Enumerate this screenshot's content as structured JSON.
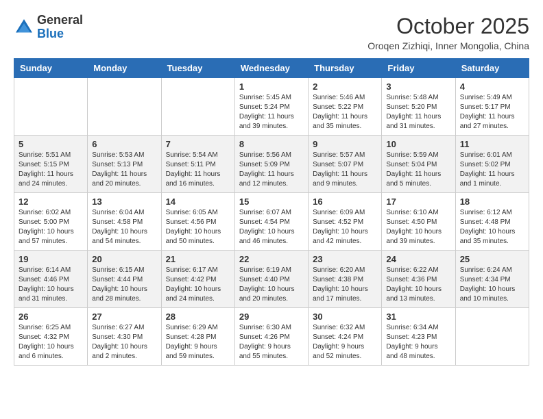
{
  "logo": {
    "general": "General",
    "blue": "Blue"
  },
  "header": {
    "month": "October 2025",
    "location": "Oroqen Zizhiqi, Inner Mongolia, China"
  },
  "weekdays": [
    "Sunday",
    "Monday",
    "Tuesday",
    "Wednesday",
    "Thursday",
    "Friday",
    "Saturday"
  ],
  "weeks": [
    [
      {
        "day": "",
        "info": ""
      },
      {
        "day": "",
        "info": ""
      },
      {
        "day": "",
        "info": ""
      },
      {
        "day": "1",
        "info": "Sunrise: 5:45 AM\nSunset: 5:24 PM\nDaylight: 11 hours\nand 39 minutes."
      },
      {
        "day": "2",
        "info": "Sunrise: 5:46 AM\nSunset: 5:22 PM\nDaylight: 11 hours\nand 35 minutes."
      },
      {
        "day": "3",
        "info": "Sunrise: 5:48 AM\nSunset: 5:20 PM\nDaylight: 11 hours\nand 31 minutes."
      },
      {
        "day": "4",
        "info": "Sunrise: 5:49 AM\nSunset: 5:17 PM\nDaylight: 11 hours\nand 27 minutes."
      }
    ],
    [
      {
        "day": "5",
        "info": "Sunrise: 5:51 AM\nSunset: 5:15 PM\nDaylight: 11 hours\nand 24 minutes."
      },
      {
        "day": "6",
        "info": "Sunrise: 5:53 AM\nSunset: 5:13 PM\nDaylight: 11 hours\nand 20 minutes."
      },
      {
        "day": "7",
        "info": "Sunrise: 5:54 AM\nSunset: 5:11 PM\nDaylight: 11 hours\nand 16 minutes."
      },
      {
        "day": "8",
        "info": "Sunrise: 5:56 AM\nSunset: 5:09 PM\nDaylight: 11 hours\nand 12 minutes."
      },
      {
        "day": "9",
        "info": "Sunrise: 5:57 AM\nSunset: 5:07 PM\nDaylight: 11 hours\nand 9 minutes."
      },
      {
        "day": "10",
        "info": "Sunrise: 5:59 AM\nSunset: 5:04 PM\nDaylight: 11 hours\nand 5 minutes."
      },
      {
        "day": "11",
        "info": "Sunrise: 6:01 AM\nSunset: 5:02 PM\nDaylight: 11 hours\nand 1 minute."
      }
    ],
    [
      {
        "day": "12",
        "info": "Sunrise: 6:02 AM\nSunset: 5:00 PM\nDaylight: 10 hours\nand 57 minutes."
      },
      {
        "day": "13",
        "info": "Sunrise: 6:04 AM\nSunset: 4:58 PM\nDaylight: 10 hours\nand 54 minutes."
      },
      {
        "day": "14",
        "info": "Sunrise: 6:05 AM\nSunset: 4:56 PM\nDaylight: 10 hours\nand 50 minutes."
      },
      {
        "day": "15",
        "info": "Sunrise: 6:07 AM\nSunset: 4:54 PM\nDaylight: 10 hours\nand 46 minutes."
      },
      {
        "day": "16",
        "info": "Sunrise: 6:09 AM\nSunset: 4:52 PM\nDaylight: 10 hours\nand 42 minutes."
      },
      {
        "day": "17",
        "info": "Sunrise: 6:10 AM\nSunset: 4:50 PM\nDaylight: 10 hours\nand 39 minutes."
      },
      {
        "day": "18",
        "info": "Sunrise: 6:12 AM\nSunset: 4:48 PM\nDaylight: 10 hours\nand 35 minutes."
      }
    ],
    [
      {
        "day": "19",
        "info": "Sunrise: 6:14 AM\nSunset: 4:46 PM\nDaylight: 10 hours\nand 31 minutes."
      },
      {
        "day": "20",
        "info": "Sunrise: 6:15 AM\nSunset: 4:44 PM\nDaylight: 10 hours\nand 28 minutes."
      },
      {
        "day": "21",
        "info": "Sunrise: 6:17 AM\nSunset: 4:42 PM\nDaylight: 10 hours\nand 24 minutes."
      },
      {
        "day": "22",
        "info": "Sunrise: 6:19 AM\nSunset: 4:40 PM\nDaylight: 10 hours\nand 20 minutes."
      },
      {
        "day": "23",
        "info": "Sunrise: 6:20 AM\nSunset: 4:38 PM\nDaylight: 10 hours\nand 17 minutes."
      },
      {
        "day": "24",
        "info": "Sunrise: 6:22 AM\nSunset: 4:36 PM\nDaylight: 10 hours\nand 13 minutes."
      },
      {
        "day": "25",
        "info": "Sunrise: 6:24 AM\nSunset: 4:34 PM\nDaylight: 10 hours\nand 10 minutes."
      }
    ],
    [
      {
        "day": "26",
        "info": "Sunrise: 6:25 AM\nSunset: 4:32 PM\nDaylight: 10 hours\nand 6 minutes."
      },
      {
        "day": "27",
        "info": "Sunrise: 6:27 AM\nSunset: 4:30 PM\nDaylight: 10 hours\nand 2 minutes."
      },
      {
        "day": "28",
        "info": "Sunrise: 6:29 AM\nSunset: 4:28 PM\nDaylight: 9 hours\nand 59 minutes."
      },
      {
        "day": "29",
        "info": "Sunrise: 6:30 AM\nSunset: 4:26 PM\nDaylight: 9 hours\nand 55 minutes."
      },
      {
        "day": "30",
        "info": "Sunrise: 6:32 AM\nSunset: 4:24 PM\nDaylight: 9 hours\nand 52 minutes."
      },
      {
        "day": "31",
        "info": "Sunrise: 6:34 AM\nSunset: 4:23 PM\nDaylight: 9 hours\nand 48 minutes."
      },
      {
        "day": "",
        "info": ""
      }
    ]
  ]
}
